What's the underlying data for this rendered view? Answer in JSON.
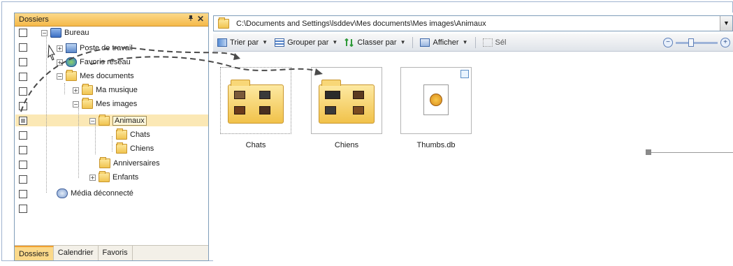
{
  "left_panel": {
    "title": "Dossiers",
    "pin_icon": "pin-icon",
    "close_glyph": "✕",
    "tree": [
      {
        "label": "Bureau",
        "icon": "desktop-icon"
      },
      {
        "label": "Poste de travail",
        "icon": "computer-icon"
      },
      {
        "label": "Favoris réseau",
        "icon": "network-icon"
      },
      {
        "label": "Mes documents",
        "icon": "documents-folder-icon"
      },
      {
        "label": "Ma musique",
        "icon": "music-folder-icon"
      },
      {
        "label": "Mes images",
        "icon": "folder-icon"
      },
      {
        "label": "Animaux",
        "icon": "folder-icon"
      },
      {
        "label": "Chats",
        "icon": "folder-icon"
      },
      {
        "label": "Chiens",
        "icon": "folder-icon"
      },
      {
        "label": "Anniversaires",
        "icon": "folder-icon"
      },
      {
        "label": "Enfants",
        "icon": "folder-icon"
      },
      {
        "label": "Média déconnecté",
        "icon": "disconnected-media-icon"
      }
    ],
    "tabs": [
      "Dossiers",
      "Calendrier",
      "Favoris"
    ],
    "active_tab": "Dossiers"
  },
  "address_bar": {
    "path": "C:\\Documents and Settings\\lsddev\\Mes documents\\Mes images\\Animaux"
  },
  "toolbar": {
    "items": [
      {
        "label": "Trier par",
        "icon": "sort-icon"
      },
      {
        "label": "Grouper par",
        "icon": "group-icon"
      },
      {
        "label": "Classer par",
        "icon": "arrange-icon"
      },
      {
        "label": "Afficher",
        "icon": "view-icon"
      },
      {
        "label": "Sél",
        "icon": "select-icon"
      }
    ]
  },
  "content": {
    "items": [
      {
        "label": "Chats",
        "type": "folder"
      },
      {
        "label": "Chiens",
        "type": "folder"
      },
      {
        "label": "Thumbs.db",
        "type": "file"
      }
    ]
  },
  "colors": {
    "panel_header": "#f5b94a",
    "selection": "#fbe8b5",
    "border": "#7f9db9"
  }
}
